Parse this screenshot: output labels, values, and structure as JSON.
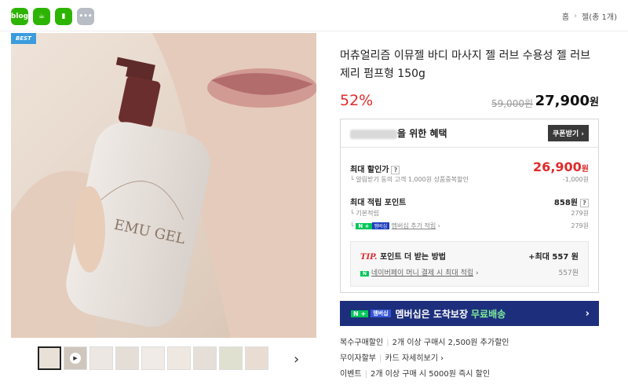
{
  "share": {
    "icons": [
      "blog-icon",
      "cafe-icon",
      "bookmark-icon",
      "more-icon"
    ],
    "colors": [
      "#2db400",
      "#2db400",
      "#2db400",
      "#999999"
    ]
  },
  "breadcrumb": {
    "home": "홈",
    "current": "젤(총 1개)"
  },
  "product": {
    "badge": "BEST",
    "title": "머츄얼리즘 이뮤젤 바디 마사지 젤 러브 수용성 젤 러브제리 펌프형 150g",
    "discount": "52%",
    "original_price": "59,000원",
    "sale_price": "27,900",
    "sale_unit": "원"
  },
  "benefit": {
    "header_suffix": "을 위한 혜택",
    "coupon_button": "쿠폰받기 ›",
    "max_discount_label": "최대 할인가",
    "max_discount_value": "26,900",
    "max_discount_unit": "원",
    "alarm_note": "알림받기 동의 고객 1,000원 상품중복할인",
    "alarm_value": "-1,000원",
    "points_label": "최대 적립 포인트",
    "points_value": "858원",
    "base_label": "기본적립",
    "base_value": "279원",
    "member_label": "멤버십 추가 적립",
    "member_value": "279원",
    "tip_label": "TIP.",
    "tip_text": "포인트 더 받는 방법",
    "tip_value": "+최대 557 원",
    "pay_label": "네이버페이 머니 결제 시 최대 적립",
    "pay_value": "557원"
  },
  "banner": {
    "badge": "멤버십",
    "text": "멤버십은 도착보장",
    "highlight": "무료배송",
    "arrow": "›"
  },
  "extras": [
    {
      "label": "복수구매할인",
      "value": "2개 이상 구매시 2,500원 추가할인"
    },
    {
      "label": "무이자할부",
      "value": "카드 자세히보기 ›"
    },
    {
      "label": "이벤트",
      "value": "2개 이상 구매 시 5000원 즉시 할인"
    }
  ],
  "photo_text": {
    "brand": "EMU GEL"
  }
}
